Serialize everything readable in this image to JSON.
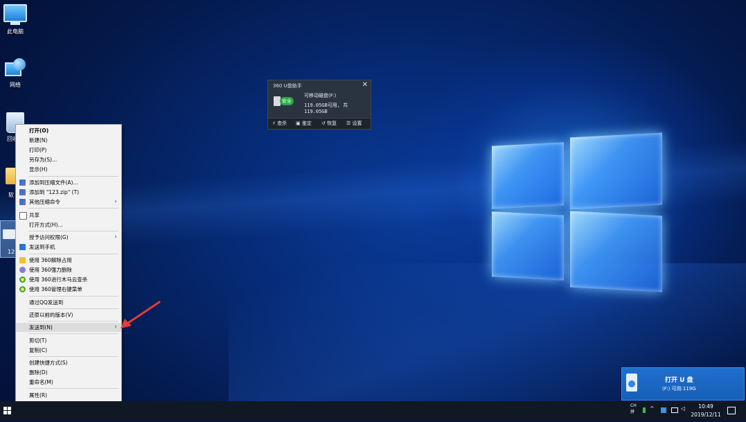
{
  "desktop": {
    "icons": [
      {
        "label": "此电脑"
      },
      {
        "label": "网络"
      },
      {
        "label": "回收"
      },
      {
        "label": "软"
      },
      {
        "label": "12"
      }
    ]
  },
  "u360": {
    "title": "360 U盘助手",
    "close": "✕",
    "badge": "安全",
    "disk_name": "可移动磁盘(F:)",
    "space": "119.05GB可用, 共119.05GB",
    "actions": [
      {
        "icon": "bolt-icon",
        "label": "查杀"
      },
      {
        "icon": "lock-icon",
        "label": "鉴定"
      },
      {
        "icon": "restore-icon",
        "label": "恢复"
      },
      {
        "icon": "settings-icon",
        "label": "设置"
      }
    ]
  },
  "context_menu": {
    "items": [
      {
        "label": "打开(O)",
        "icon": "",
        "bold": true
      },
      {
        "label": "新建(N)",
        "icon": ""
      },
      {
        "label": "打印(P)",
        "icon": ""
      },
      {
        "label": "另存为(S)...",
        "icon": ""
      },
      {
        "label": "显示(H)",
        "icon": ""
      },
      {
        "label": "添加到压缩文件(A)...",
        "icon": "rar"
      },
      {
        "label": "添加到 \"123.zip\" (T)",
        "icon": "rar"
      },
      {
        "label": "其他压缩命令",
        "icon": "rar",
        "submenu": true
      },
      {
        "label": "共享",
        "icon": "share"
      },
      {
        "label": "打开方式(H)...",
        "icon": ""
      },
      {
        "label": "授予访问权限(G)",
        "icon": "",
        "submenu": true
      },
      {
        "label": "发送到手机",
        "icon": "phone"
      },
      {
        "label": "使用 360解除占用",
        "icon": "yellow"
      },
      {
        "label": "使用 360强力删除",
        "icon": "purple"
      },
      {
        "label": "使用 360进行木马云查杀",
        "icon": "green360"
      },
      {
        "label": "使用 360管理右键菜单",
        "icon": "green360"
      },
      {
        "label": "通过QQ发送到",
        "icon": ""
      },
      {
        "label": "还原以前的版本(V)",
        "icon": ""
      },
      {
        "label": "发送到(N)",
        "icon": "",
        "submenu": true,
        "highlighted": true
      },
      {
        "label": "剪切(T)",
        "icon": ""
      },
      {
        "label": "复制(C)",
        "icon": ""
      },
      {
        "label": "创建快捷方式(S)",
        "icon": ""
      },
      {
        "label": "删除(D)",
        "icon": ""
      },
      {
        "label": "重命名(M)",
        "icon": ""
      },
      {
        "label": "属性(R)",
        "icon": ""
      }
    ],
    "submenu_glyph": "›"
  },
  "open_u": {
    "title": "打开 U 盘",
    "subtitle": "(F:)  可用:119G"
  },
  "taskbar": {
    "ime_top": "CH",
    "ime_bottom": "拼",
    "time": "10:49",
    "date": "2019/12/11"
  },
  "colors": {
    "accent": "#1f6fcf",
    "safe_green": "#27a845",
    "arrow_red": "#e23b3b"
  }
}
